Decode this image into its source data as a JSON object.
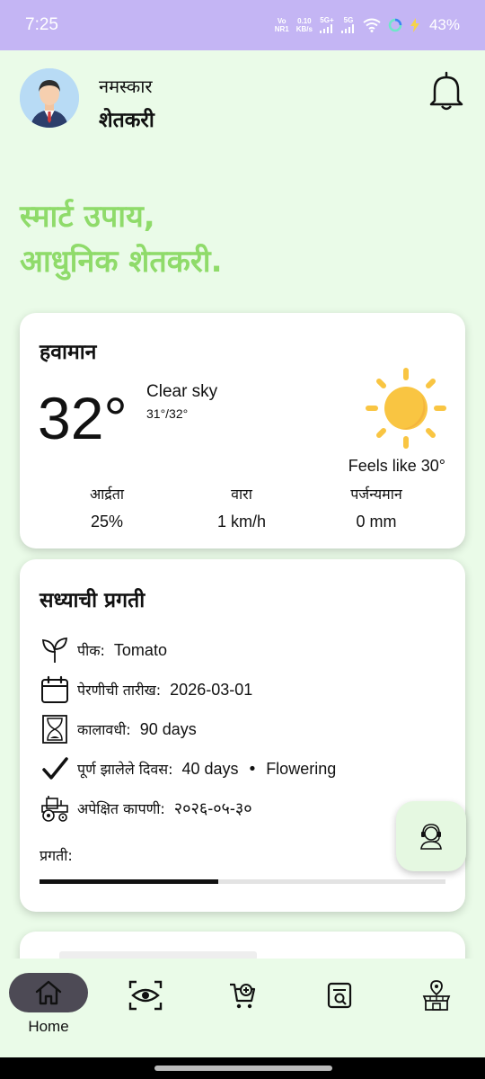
{
  "status_bar": {
    "time": "7:25",
    "network_line1": "Vo",
    "network_line2": "NR1",
    "speed_value": "0.10",
    "speed_unit": "KB/s",
    "sig1": "5G+",
    "sig2": "5G",
    "battery": "43%"
  },
  "header": {
    "greeting": "नमस्कार",
    "name": "शेतकरी"
  },
  "headline": {
    "line1": "स्मार्ट उपाय,",
    "line2": "आधुनिक शेतकरी."
  },
  "weather": {
    "title": "हवामान",
    "temperature": "32°",
    "condition": "Clear sky",
    "range": "31°/32°",
    "feels_like": "Feels like 30°",
    "humidity_label": "आर्द्रता",
    "humidity_value": "25%",
    "wind_label": "वारा",
    "wind_value": "1 km/h",
    "rain_label": "पर्जन्यमान",
    "rain_value": "0 mm"
  },
  "progress": {
    "title": "सध्याची प्रगती",
    "crop_label": "पीक:",
    "crop_value": "Tomato",
    "sowing_label": "पेरणीची तारीख:",
    "sowing_value": "2026-03-01",
    "duration_label": "कालावधी:",
    "duration_value": "90 days",
    "completed_label": "पूर्ण झालेले दिवस:",
    "completed_value": "40 days",
    "bullet": "•",
    "stage": "Flowering",
    "harvest_label": "अपेक्षित कापणी:",
    "harvest_value": "२०२६-०५-३०",
    "progress_label": "प्रगती:",
    "progress_fraction": 0.44
  },
  "nav": {
    "home_label": "Home"
  },
  "colors": {
    "background": "#eafbe8",
    "status_bar": "#c4b5f4",
    "headline": "#8fdb6a",
    "sun": "#f9c542",
    "nav_active": "#4d4a55"
  }
}
